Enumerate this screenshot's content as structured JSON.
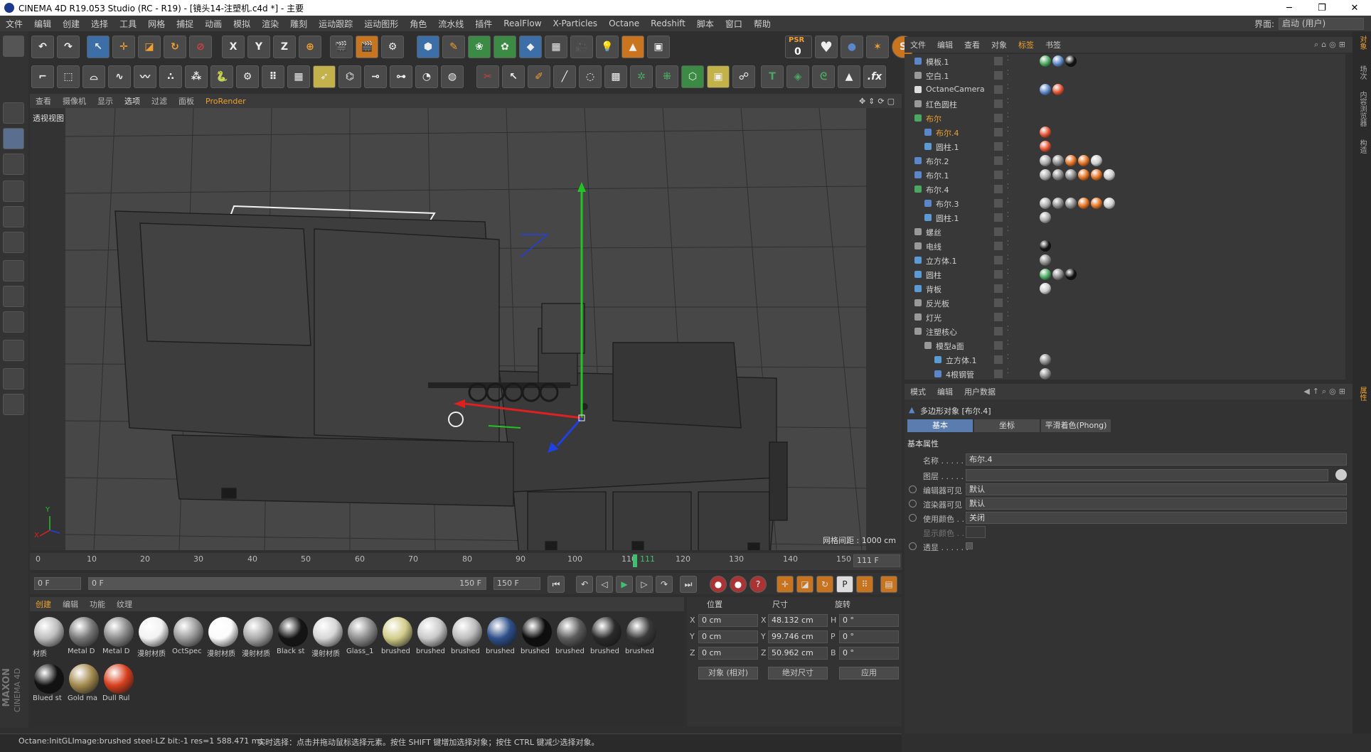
{
  "window": {
    "title": "CINEMA 4D R19.053 Studio (RC - R19) - [镜头14-注塑机.c4d *] - 主要",
    "controls": [
      "─",
      "❐",
      "✕"
    ]
  },
  "menu": {
    "items": [
      "文件",
      "编辑",
      "创建",
      "选择",
      "工具",
      "网格",
      "捕捉",
      "动画",
      "模拟",
      "渲染",
      "雕刻",
      "运动跟踪",
      "运动图形",
      "角色",
      "流水线",
      "插件",
      "RealFlow",
      "X-Particles",
      "Octane",
      "Redshift",
      "脚本",
      "窗口",
      "帮助"
    ],
    "interface_label": "界面:",
    "interface_value": "启动 (用户)"
  },
  "toolbar": {
    "psr_label": "PSR",
    "psr_value": "0"
  },
  "viewport": {
    "menu": [
      "查看",
      "摄像机",
      "显示",
      "选项",
      "过滤",
      "面板",
      "ProRender"
    ],
    "active_menu": "选项",
    "view_name": "透视视图",
    "grid_spacing": "网格间距 : 1000 cm",
    "axis_y": "Y",
    "axis_x": "X"
  },
  "timeline": {
    "ticks": [
      "0",
      "10",
      "20",
      "30",
      "40",
      "50",
      "60",
      "70",
      "80",
      "90",
      "100",
      "110",
      "120",
      "130",
      "140",
      "150"
    ],
    "current_frame_marker": "111",
    "current_frame_field": "111 F",
    "start_field": "0 F",
    "range_start": "0 F",
    "range_end": "150 F",
    "end_field": "150 F"
  },
  "materials": {
    "menu": [
      "创建",
      "编辑",
      "功能",
      "纹理"
    ],
    "active_menu": "创建",
    "items": [
      {
        "label": "材质",
        "color": "#bdbdbd"
      },
      {
        "label": "Metal D",
        "color": "#777777"
      },
      {
        "label": "Metal D",
        "color": "#8a8a8a"
      },
      {
        "label": "漫射材质",
        "color": "#f2f2f2"
      },
      {
        "label": "OctSpec",
        "color": "#9a9a9a"
      },
      {
        "label": "漫射材质",
        "color": "#fbfbfb"
      },
      {
        "label": "漫射材质",
        "color": "#a9a9a9"
      },
      {
        "label": "Black st",
        "color": "#151515"
      },
      {
        "label": "漫射材质",
        "color": "#d6d6d6"
      },
      {
        "label": "Glass_1",
        "color": "#8d8d8d"
      },
      {
        "label": "brushed",
        "color": "#d2cd8a"
      },
      {
        "label": "brushed",
        "color": "#c9c9c9"
      },
      {
        "label": "brushed",
        "color": "#bcbcbc"
      },
      {
        "label": "brushed",
        "color": "#2e4f8a"
      },
      {
        "label": "brushed",
        "color": "#0d0d0d"
      },
      {
        "label": "brushed",
        "color": "#5c5c5c"
      },
      {
        "label": "brushed",
        "color": "#2a2a2a"
      },
      {
        "label": "brushed",
        "color": "#3a3a3a"
      },
      {
        "label": "Blued st",
        "color": "#121212"
      },
      {
        "label": "Gold ma",
        "color": "#a38a4f"
      },
      {
        "label": "Dull Rul",
        "color": "#d8401e"
      }
    ]
  },
  "coordinates": {
    "headers": [
      "位置",
      "尺寸",
      "旋转"
    ],
    "rows": [
      {
        "axis": "X",
        "pos": "0 cm",
        "size": "48.132 cm",
        "rot_label": "H",
        "rot": "0 °"
      },
      {
        "axis": "Y",
        "pos": "0 cm",
        "size": "99.746 cm",
        "rot_label": "P",
        "rot": "0 °"
      },
      {
        "axis": "Z",
        "pos": "0 cm",
        "size": "50.962 cm",
        "rot_label": "B",
        "rot": "0 °"
      }
    ],
    "mode": "对象 (相对)",
    "size_mode": "绝对尺寸",
    "apply": "应用"
  },
  "status": {
    "left": "Octane:InitGLImage:brushed steel-LZ  bit:-1 res=1  588.471 ms.",
    "right": "实时选择：点击并拖动鼠标选择元素。按住 SHIFT 键增加选择对象；按住 CTRL 键减少选择对象。"
  },
  "object_manager": {
    "menu": [
      "文件",
      "编辑",
      "查看",
      "对象",
      "标签",
      "书签"
    ],
    "active_menu": "标签",
    "objects": [
      {
        "name": "模板.1",
        "indent": 1,
        "selected": false,
        "icon": "#5b86c9"
      },
      {
        "name": "空白.1",
        "indent": 1,
        "selected": false,
        "icon": "#999999"
      },
      {
        "name": "OctaneCamera",
        "indent": 1,
        "selected": false,
        "icon": "#dddddd"
      },
      {
        "name": "红色圆柱",
        "indent": 1,
        "selected": false,
        "icon": "#999999"
      },
      {
        "name": "布尔",
        "indent": 1,
        "selected": true,
        "icon": "#4aa860"
      },
      {
        "name": "布尔.4",
        "indent": 2,
        "selected": true,
        "icon": "#5b86c9"
      },
      {
        "name": "圆柱.1",
        "indent": 2,
        "selected": false,
        "icon": "#5b9bd5"
      },
      {
        "name": "布尔.2",
        "indent": 1,
        "selected": false,
        "icon": "#5b86c9"
      },
      {
        "name": "布尔.1",
        "indent": 1,
        "selected": false,
        "icon": "#5b86c9"
      },
      {
        "name": "布尔.4",
        "indent": 1,
        "selected": false,
        "icon": "#4aa860"
      },
      {
        "name": "布尔.3",
        "indent": 2,
        "selected": false,
        "icon": "#5b86c9"
      },
      {
        "name": "圆柱.1",
        "indent": 2,
        "selected": false,
        "icon": "#5b9bd5"
      },
      {
        "name": "螺丝",
        "indent": 1,
        "selected": false,
        "icon": "#999999"
      },
      {
        "name": "电线",
        "indent": 1,
        "selected": false,
        "icon": "#999999"
      },
      {
        "name": "立方体.1",
        "indent": 1,
        "selected": false,
        "icon": "#5b9bd5"
      },
      {
        "name": "圆柱",
        "indent": 1,
        "selected": false,
        "icon": "#5b9bd5"
      },
      {
        "name": "背板",
        "indent": 1,
        "selected": false,
        "icon": "#5b9bd5"
      },
      {
        "name": "反光板",
        "indent": 1,
        "selected": false,
        "icon": "#999999"
      },
      {
        "name": "灯光",
        "indent": 1,
        "selected": false,
        "icon": "#999999"
      },
      {
        "name": "注塑核心",
        "indent": 1,
        "selected": false,
        "icon": "#999999"
      },
      {
        "name": "模型a面",
        "indent": 2,
        "selected": false,
        "icon": "#999999"
      },
      {
        "name": "立方体.1",
        "indent": 3,
        "selected": false,
        "icon": "#5b9bd5"
      },
      {
        "name": "4根钢管",
        "indent": 3,
        "selected": false,
        "icon": "#5b86c9"
      }
    ]
  },
  "attributes": {
    "menu": [
      "模式",
      "编辑",
      "用户数据"
    ],
    "object_title": "多边形对象 [布尔.4]",
    "tabs": [
      "基本",
      "坐标",
      "平滑着色(Phong)"
    ],
    "active_tab": "基本",
    "section": "基本属性",
    "fields": [
      {
        "label": "名称 . . . . . .",
        "value": "布尔.4"
      },
      {
        "label": "图层 . . . . . .",
        "value": ""
      },
      {
        "label": "编辑器可见",
        "value": "默认"
      },
      {
        "label": "渲染器可见",
        "value": "默认"
      },
      {
        "label": "使用颜色 . .",
        "value": "关闭"
      },
      {
        "label": "显示颜色 . .",
        "value": ""
      },
      {
        "label": "透显 . . . . . .",
        "value": ""
      }
    ]
  },
  "right_strip": [
    "对象",
    "场次",
    "内容浏览器",
    "构造"
  ],
  "right_strip_lower": [
    "属性"
  ],
  "brand": {
    "line1": "MAXON",
    "line2": "CINEMA 4D"
  },
  "colors": {
    "accent": "#f0a030",
    "selection_blue": "#5b7cae",
    "playhead": "#3fbf6f"
  }
}
